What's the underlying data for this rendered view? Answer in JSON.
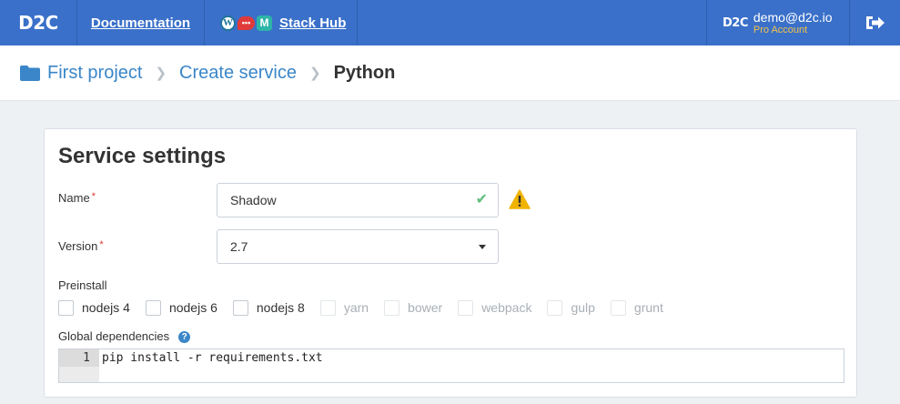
{
  "topbar": {
    "logo": "D2C",
    "documentation": "Documentation",
    "stackhub": "Stack Hub",
    "stackhub_icons": [
      "wordpress-icon",
      "chat-icon",
      "m-icon"
    ],
    "account_logo": "D2C",
    "account_email": "demo@d2c.io",
    "account_plan": "Pro Account",
    "logout_icon": "sign-out-icon",
    "color": "#3a70c9"
  },
  "breadcrumb": {
    "items": [
      "First project",
      "Create service"
    ],
    "current": "Python",
    "folder_icon": "folder-icon"
  },
  "form": {
    "title": "Service settings",
    "name_label": "Name",
    "required_mark": "*",
    "name_value": "Shadow",
    "version_label": "Version",
    "version_value": "2.7",
    "preinstall_label": "Preinstall",
    "preinstall_options": [
      {
        "label": "nodejs 4",
        "enabled": true,
        "checked": false
      },
      {
        "label": "nodejs 6",
        "enabled": true,
        "checked": false
      },
      {
        "label": "nodejs 8",
        "enabled": true,
        "checked": false
      },
      {
        "label": "yarn",
        "enabled": false,
        "checked": false
      },
      {
        "label": "bower",
        "enabled": false,
        "checked": false
      },
      {
        "label": "webpack",
        "enabled": false,
        "checked": false
      },
      {
        "label": "gulp",
        "enabled": false,
        "checked": false
      },
      {
        "label": "grunt",
        "enabled": false,
        "checked": false
      }
    ],
    "global_deps_label": "Global dependencies",
    "help_icon": "?",
    "editor": {
      "line_number": "1",
      "code": "pip install -r requirements.txt"
    }
  },
  "colors": {
    "link": "#3a86c8",
    "success": "#5fbf7b",
    "warning": "#f0b400",
    "required": "#dd3333"
  }
}
